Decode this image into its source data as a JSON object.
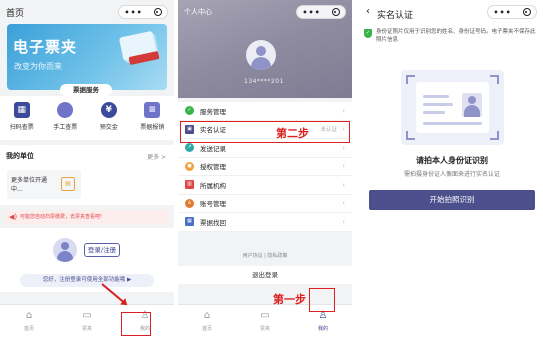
{
  "panel1": {
    "title": "首页",
    "banner": {
      "big": "电子票夹",
      "sub": "改变为你而来"
    },
    "service_pill": "票据服务",
    "services": [
      {
        "label": "扫码查票",
        "icon": "qr-scan-icon",
        "color": "#3b4a9a"
      },
      {
        "label": "手工查票",
        "icon": "pill-icon",
        "color": "#6f74c9"
      },
      {
        "label": "预交金",
        "icon": "yen-icon",
        "color": "#3b4a9a"
      },
      {
        "label": "票据报销",
        "icon": "document-icon",
        "color": "#6f74c9"
      }
    ],
    "units": {
      "header": "我的单位",
      "more": "更多 >",
      "card_text": "更多单位开通中..."
    },
    "notice": "可能您自动扫票缴费，去票夹查看吧!",
    "login_button": "登录/注册",
    "hint": "您好，注册登录可使用全部功能哦 ▶",
    "tabs": [
      {
        "label": "首页",
        "icon": "home-icon"
      },
      {
        "label": "票夹",
        "icon": "wallet-icon"
      },
      {
        "label": "我的",
        "icon": "user-icon"
      }
    ]
  },
  "panel2": {
    "title": "个人中心",
    "phone": "134****201",
    "menu": [
      {
        "label": "服务管理",
        "value": "",
        "icon": "service-icon",
        "color": "#39b34a"
      },
      {
        "label": "实名认证",
        "value": "未认证",
        "icon": "id-card-icon",
        "color": "#4b4f8c"
      },
      {
        "label": "发送记录",
        "value": "",
        "icon": "send-icon",
        "color": "#2fa8a8"
      },
      {
        "label": "授权管理",
        "value": "",
        "icon": "auth-icon",
        "color": "#f0a13a"
      },
      {
        "label": "所属机构",
        "value": "",
        "icon": "org-icon",
        "color": "#e04848"
      },
      {
        "label": "账号管理",
        "value": "",
        "icon": "account-icon",
        "color": "#e07a2f"
      },
      {
        "label": "票据找回",
        "value": "",
        "icon": "retrieve-icon",
        "color": "#4b6fc9"
      }
    ],
    "step2": "第二步",
    "step1": "第一步",
    "footer_links": "用户协议 | 隐私政策",
    "logout": "退出登录",
    "tabs": [
      {
        "label": "首页",
        "icon": "home-icon"
      },
      {
        "label": "票夹",
        "icon": "wallet-icon"
      },
      {
        "label": "我的",
        "icon": "user-icon"
      }
    ]
  },
  "panel3": {
    "title": "实名认证",
    "info": "身份证照片仅用于识别您的姓名、身份证号码。电子票夹不保存此照片信息",
    "heading": "请拍本人身份证识别",
    "sub": "需拍摄身份证人像面来进行实名认证",
    "button": "开始拍照识别"
  },
  "capsule": {
    "dots": "•••",
    "close_icon": "target-icon"
  }
}
